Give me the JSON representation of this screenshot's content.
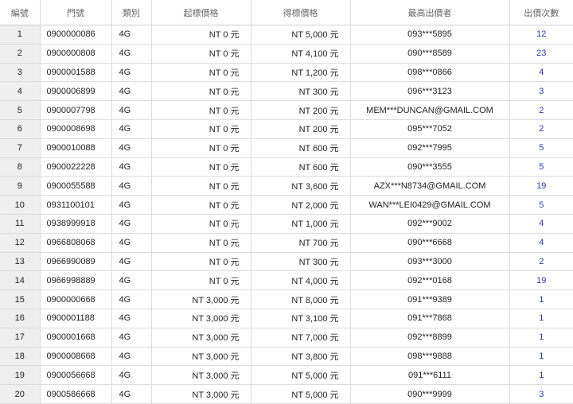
{
  "headers": {
    "no": "編號",
    "number": "門號",
    "type": "類別",
    "start_price": "起標價格",
    "final_price": "得標價格",
    "top_bidder": "最高出價者",
    "bid_count": "出價次數"
  },
  "rows": [
    {
      "no": "1",
      "number": "0900000086",
      "type": "4G",
      "start_price": "NT 0 元",
      "final_price": "NT 5,000 元",
      "top_bidder": "093***5895",
      "bid_count": "12"
    },
    {
      "no": "2",
      "number": "0900000808",
      "type": "4G",
      "start_price": "NT 0 元",
      "final_price": "NT 4,100 元",
      "top_bidder": "090***8589",
      "bid_count": "23"
    },
    {
      "no": "3",
      "number": "0900001588",
      "type": "4G",
      "start_price": "NT 0 元",
      "final_price": "NT 1,200 元",
      "top_bidder": "098***0866",
      "bid_count": "4"
    },
    {
      "no": "4",
      "number": "0900006899",
      "type": "4G",
      "start_price": "NT 0 元",
      "final_price": "NT 300 元",
      "top_bidder": "096***3123",
      "bid_count": "3"
    },
    {
      "no": "5",
      "number": "0900007798",
      "type": "4G",
      "start_price": "NT 0 元",
      "final_price": "NT 200 元",
      "top_bidder": "MEM***DUNCAN@GMAIL.COM",
      "bid_count": "2"
    },
    {
      "no": "6",
      "number": "0900008698",
      "type": "4G",
      "start_price": "NT 0 元",
      "final_price": "NT 200 元",
      "top_bidder": "095***7052",
      "bid_count": "2"
    },
    {
      "no": "7",
      "number": "0900010088",
      "type": "4G",
      "start_price": "NT 0 元",
      "final_price": "NT 600 元",
      "top_bidder": "092***7995",
      "bid_count": "5"
    },
    {
      "no": "8",
      "number": "0900022228",
      "type": "4G",
      "start_price": "NT 0 元",
      "final_price": "NT 600 元",
      "top_bidder": "090***3555",
      "bid_count": "5"
    },
    {
      "no": "9",
      "number": "0900055588",
      "type": "4G",
      "start_price": "NT 0 元",
      "final_price": "NT 3,600 元",
      "top_bidder": "AZX***N8734@GMAIL.COM",
      "bid_count": "19"
    },
    {
      "no": "10",
      "number": "0931100101",
      "type": "4G",
      "start_price": "NT 0 元",
      "final_price": "NT 2,000 元",
      "top_bidder": "WAN***LEI0429@GMAIL.COM",
      "bid_count": "5"
    },
    {
      "no": "11",
      "number": "0938999918",
      "type": "4G",
      "start_price": "NT 0 元",
      "final_price": "NT 1,000 元",
      "top_bidder": "092***9002",
      "bid_count": "4"
    },
    {
      "no": "12",
      "number": "0966808068",
      "type": "4G",
      "start_price": "NT 0 元",
      "final_price": "NT 700 元",
      "top_bidder": "090***6668",
      "bid_count": "4"
    },
    {
      "no": "13",
      "number": "0966990089",
      "type": "4G",
      "start_price": "NT 0 元",
      "final_price": "NT 300 元",
      "top_bidder": "093***3000",
      "bid_count": "2"
    },
    {
      "no": "14",
      "number": "0966998889",
      "type": "4G",
      "start_price": "NT 0 元",
      "final_price": "NT 4,000 元",
      "top_bidder": "092***0168",
      "bid_count": "19"
    },
    {
      "no": "15",
      "number": "0900000668",
      "type": "4G",
      "start_price": "NT 3,000 元",
      "final_price": "NT 8,000 元",
      "top_bidder": "091***9389",
      "bid_count": "1"
    },
    {
      "no": "16",
      "number": "0900001188",
      "type": "4G",
      "start_price": "NT 3,000 元",
      "final_price": "NT 3,100 元",
      "top_bidder": "091***7868",
      "bid_count": "1"
    },
    {
      "no": "17",
      "number": "0900001668",
      "type": "4G",
      "start_price": "NT 3,000 元",
      "final_price": "NT 7,000 元",
      "top_bidder": "092***8899",
      "bid_count": "1"
    },
    {
      "no": "18",
      "number": "0900008668",
      "type": "4G",
      "start_price": "NT 3,000 元",
      "final_price": "NT 3,800 元",
      "top_bidder": "098***9888",
      "bid_count": "1"
    },
    {
      "no": "19",
      "number": "0900056668",
      "type": "4G",
      "start_price": "NT 3,000 元",
      "final_price": "NT 5,000 元",
      "top_bidder": "091***6111",
      "bid_count": "1"
    },
    {
      "no": "20",
      "number": "0900586668",
      "type": "4G",
      "start_price": "NT 3,000 元",
      "final_price": "NT 5,000 元",
      "top_bidder": "090***9999",
      "bid_count": "3"
    }
  ]
}
